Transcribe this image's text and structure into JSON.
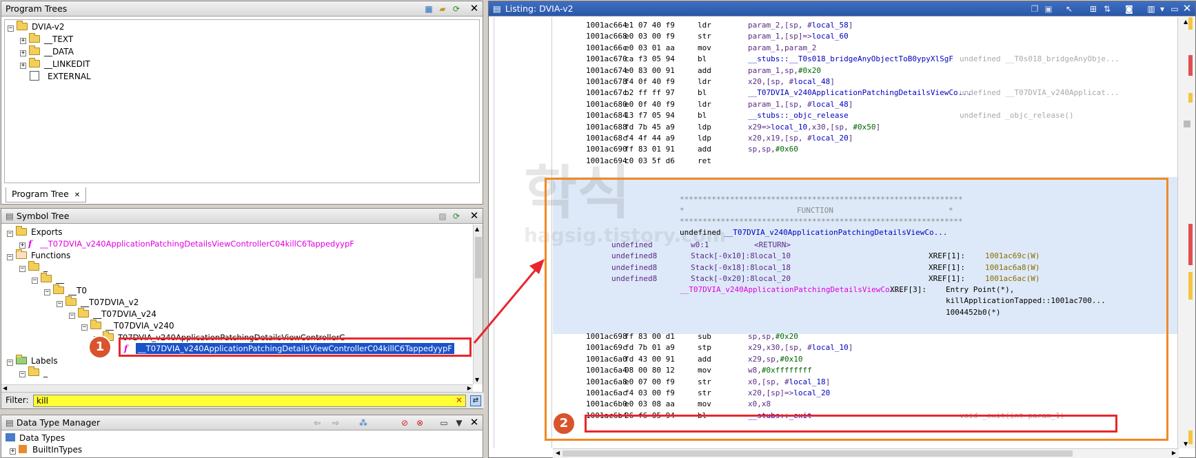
{
  "program_trees": {
    "title": "Program Trees",
    "root": "DVIA-v2",
    "children": [
      "__TEXT",
      "__DATA",
      "__LINKEDIT",
      "EXTERNAL"
    ],
    "tab_label": "Program Tree"
  },
  "symbol_tree": {
    "title": "Symbol Tree",
    "exports": "Exports",
    "export_fn": "__T07DVIA_v240ApplicationPatchingDetailsViewControllerC04killC6TappedyypF",
    "functions": "Functions",
    "ns": [
      "_",
      "__",
      "__T0",
      "__T07DVIA_v2",
      "__T07DVIA_v24",
      "__T07DVIA_v240",
      "T07DVIA_v240ApplicationPatchingDetailsViewControllerC"
    ],
    "selected_fn": "__T07DVIA_v240ApplicationPatchingDetailsViewControllerC04killC6TappedyypF",
    "labels": "Labels",
    "labels_child": "_"
  },
  "filter": {
    "label": "Filter:",
    "value": "kill"
  },
  "data_type_manager": {
    "title": "Data Type Manager",
    "items": [
      "Data Types",
      "BuiltInTypes"
    ]
  },
  "listing": {
    "title": "Listing:  DVIA-v2",
    "top_lines": [
      {
        "addr": "1001ac664",
        "bytes": "e1 07 40 f9",
        "mn": "ldr",
        "ops": "param_2,[sp, #local_58]",
        "cmt": ""
      },
      {
        "addr": "1001ac668",
        "bytes": "e0 03 00 f9",
        "mn": "str",
        "ops": "param_1,[sp]=>local_60",
        "cmt": ""
      },
      {
        "addr": "1001ac66c",
        "bytes": "e0 03 01 aa",
        "mn": "mov",
        "ops": "param_1,param_2",
        "cmt": ""
      },
      {
        "addr": "1001ac670",
        "bytes": "ca f3 05 94",
        "mn": "bl",
        "ops": "__stubs::__T0s018_bridgeAnyObjectToB0ypyXlSgF",
        "cmt": "undefined __T0s018_bridgeAnyObje..."
      },
      {
        "addr": "1001ac674",
        "bytes": "e0 83 00 91",
        "mn": "add",
        "ops": "param_1,sp,#0x20",
        "cmt": ""
      },
      {
        "addr": "1001ac678",
        "bytes": "f4 0f 40 f9",
        "mn": "ldr",
        "ops": "x20,[sp, #local_48]",
        "cmt": ""
      },
      {
        "addr": "1001ac67c",
        "bytes": "b2 ff ff 97",
        "mn": "bl",
        "ops": "__T07DVIA_v240ApplicationPatchingDetailsViewCo...",
        "cmt": "undefined __T07DVIA_v240Applicat..."
      },
      {
        "addr": "1001ac680",
        "bytes": "e0 0f 40 f9",
        "mn": "ldr",
        "ops": "param_1,[sp, #local_48]",
        "cmt": ""
      },
      {
        "addr": "1001ac684",
        "bytes": "13 f7 05 94",
        "mn": "bl",
        "ops": "__stubs::_objc_release",
        "cmt": "undefined _objc_release()"
      },
      {
        "addr": "1001ac688",
        "bytes": "fd 7b 45 a9",
        "mn": "ldp",
        "ops": "x29=>local_10,x30,[sp, #0x50]",
        "cmt": ""
      },
      {
        "addr": "1001ac68c",
        "bytes": "f4 4f 44 a9",
        "mn": "ldp",
        "ops": "x20,x19,[sp, #local_20]",
        "cmt": ""
      },
      {
        "addr": "1001ac690",
        "bytes": "ff 83 01 91",
        "mn": "add",
        "ops": "sp,sp,#0x60",
        "cmt": ""
      },
      {
        "addr": "1001ac694",
        "bytes": "c0 03 5f d6",
        "mn": "ret",
        "ops": "",
        "cmt": ""
      }
    ],
    "func_header": {
      "stars": "**************************************************************",
      "star_prefix": "*",
      "star_suffix": "*",
      "label": "FUNCTION",
      "signature_type": "undefined",
      "signature_name": "__T07DVIA_v240ApplicationPatchingDetailsViewCo...",
      "vars": [
        {
          "type": "undefined",
          "loc": "w0:1",
          "name": "<RETURN>",
          "xref": "",
          "xaddr": ""
        },
        {
          "type": "undefined8",
          "loc": "Stack[-0x10]:8",
          "name": "local_10",
          "xref": "XREF[1]:",
          "xaddr": "1001ac69c(W)"
        },
        {
          "type": "undefined8",
          "loc": "Stack[-0x18]:8",
          "name": "local_18",
          "xref": "XREF[1]:",
          "xaddr": "1001ac6a8(W)"
        },
        {
          "type": "undefined8",
          "loc": "Stack[-0x20]:8",
          "name": "local_20",
          "xref": "XREF[1]:",
          "xaddr": "1001ac6ac(W)"
        }
      ],
      "label_line": "__T07DVIA_v240ApplicationPatchingDetailsViewCo...",
      "xref3": "XREF[3]:",
      "xref3_items": [
        "Entry Point(*),",
        "killApplicationTapped::1001ac700...",
        "1004452b0(*)"
      ]
    },
    "bottom_lines": [
      {
        "addr": "1001ac698",
        "bytes": "ff 83 00 d1",
        "mn": "sub",
        "ops": "sp,sp,#0x20",
        "cmt": ""
      },
      {
        "addr": "1001ac69c",
        "bytes": "fd 7b 01 a9",
        "mn": "stp",
        "ops": "x29,x30,[sp, #local_10]",
        "cmt": ""
      },
      {
        "addr": "1001ac6a0",
        "bytes": "fd 43 00 91",
        "mn": "add",
        "ops": "x29,sp,#0x10",
        "cmt": ""
      },
      {
        "addr": "1001ac6a4",
        "bytes": "08 00 80 12",
        "mn": "mov",
        "ops": "w8,#0xffffffff",
        "cmt": ""
      },
      {
        "addr": "1001ac6a8",
        "bytes": "e0 07 00 f9",
        "mn": "str",
        "ops": "x0,[sp, #local_18]",
        "cmt": ""
      },
      {
        "addr": "1001ac6ac",
        "bytes": "f4 03 00 f9",
        "mn": "str",
        "ops": "x20,[sp]=>local_20",
        "cmt": ""
      },
      {
        "addr": "1001ac6b0",
        "bytes": "e0 03 08 aa",
        "mn": "mov",
        "ops": "x0,x8",
        "cmt": ""
      },
      {
        "addr": "1001ac6b4",
        "bytes": "26 f6 05 94",
        "mn": "bl",
        "ops": "__stubs::_exit",
        "cmt": "void _exit(int param_1)"
      }
    ]
  },
  "annotations": {
    "step1": "1",
    "step2": "2"
  },
  "watermark": {
    "glyph": "학식",
    "site": "hagsig.tistory.com"
  },
  "colors": {
    "orange": "#f08a24",
    "red": "#e8262b",
    "badge": "#d9532c",
    "selected": "#1a52c9",
    "filter_bg": "#ffff33"
  }
}
